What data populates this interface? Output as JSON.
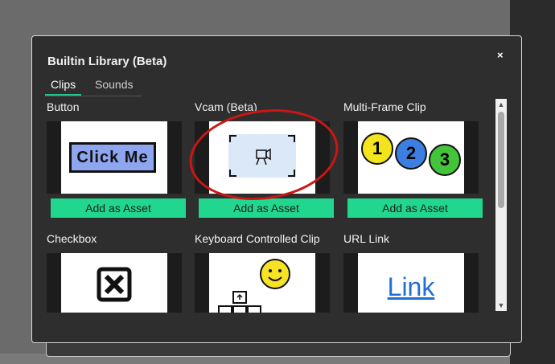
{
  "dialog": {
    "title": "Builtin Library (Beta)",
    "close_glyph": "×",
    "tabs": [
      {
        "label": "Clips",
        "active": true
      },
      {
        "label": "Sounds",
        "active": false
      }
    ]
  },
  "cards": [
    {
      "label": "Button",
      "thumb_text": "Click Me",
      "button_label": "Add as Asset"
    },
    {
      "label": "Vcam (Beta)",
      "thumb_text": "",
      "button_label": "Add as Asset"
    },
    {
      "label": "Multi-Frame Clip",
      "thumb_text": "",
      "frames": [
        "1",
        "2",
        "3"
      ],
      "button_label": "Add as Asset"
    },
    {
      "label": "Checkbox",
      "thumb_text": ""
    },
    {
      "label": "Keyboard Controlled Clip",
      "thumb_text": ""
    },
    {
      "label": "URL Link",
      "thumb_text": "Link"
    }
  ],
  "colors": {
    "accent": "#21d68e",
    "annotation": "#cc1515"
  }
}
